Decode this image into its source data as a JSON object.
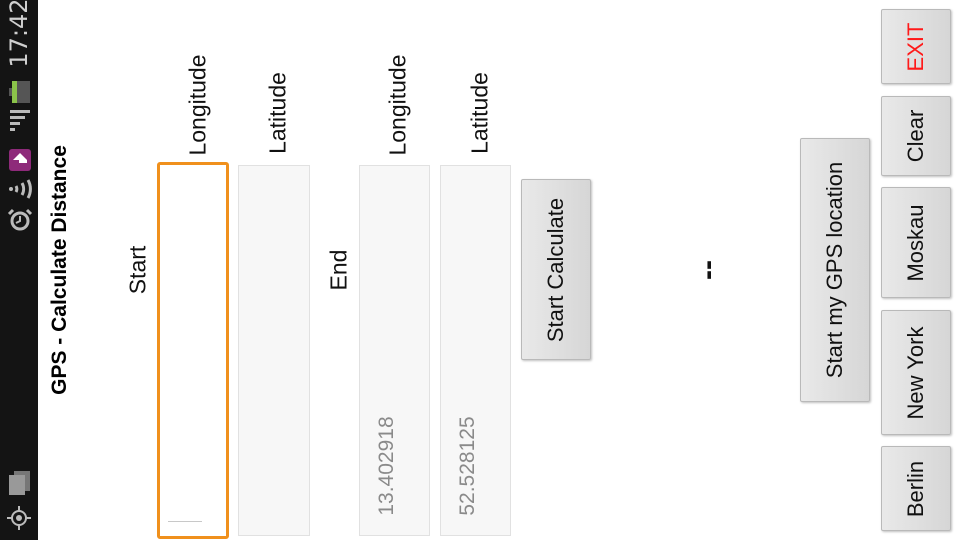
{
  "status_bar": {
    "time": "17:42",
    "icons": [
      "gps-icon",
      "notification-icon",
      "wifi-icon",
      "download-icon",
      "alarm-icon",
      "signal-icon",
      "battery-icon"
    ]
  },
  "app": {
    "title": "GPS - Calculate Distance"
  },
  "start": {
    "label": "Start",
    "longitude_label": "Longitude",
    "latitude_label": "Latitude",
    "longitude_value": "",
    "latitude_value": ""
  },
  "end": {
    "label": "End",
    "longitude_label": "Longitude",
    "latitude_label": "Latitude",
    "longitude_value": "13.402918",
    "latitude_value": "52.528125"
  },
  "calculate_button": "Start Calculate",
  "result": "--",
  "gps_button": "Start my GPS  location",
  "side_buttons": {
    "exit": "EXIT",
    "clear": "Clear",
    "moskau": "Moskau",
    "new_york": "New York",
    "berlin": "Berlin"
  },
  "colors": {
    "focus": "#f0901c",
    "exit": "#ff1a1a"
  }
}
